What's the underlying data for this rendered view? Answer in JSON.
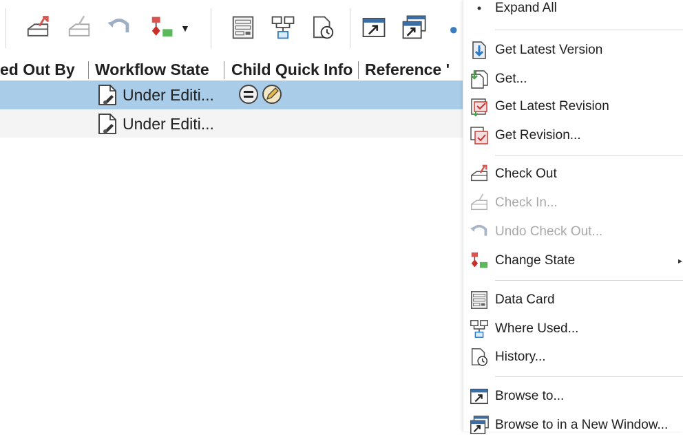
{
  "toolbar": {
    "buttons": [
      {
        "name": "check-out",
        "icon": "check-out-icon"
      },
      {
        "name": "check-in",
        "icon": "check-in-icon"
      },
      {
        "name": "undo-check-out",
        "icon": "undo-check-out-icon"
      },
      {
        "name": "change-state",
        "icon": "change-state-icon"
      },
      {
        "name": "data-card",
        "icon": "data-card-icon"
      },
      {
        "name": "where-used",
        "icon": "where-used-icon"
      },
      {
        "name": "history",
        "icon": "history-icon"
      },
      {
        "name": "browse-to",
        "icon": "browse-to-icon"
      },
      {
        "name": "browse-new-window",
        "icon": "browse-new-window-icon"
      }
    ]
  },
  "grid": {
    "columns": [
      "ed Out By",
      "Workflow State",
      "Child Quick Info",
      "Reference '"
    ],
    "rows": [
      {
        "state": "Under Editi...",
        "selected": true
      },
      {
        "state": "Under Editi...",
        "selected": false
      }
    ]
  },
  "menu": {
    "items": [
      {
        "label": "Expand All",
        "icon": "expand-icon",
        "enabled": true
      },
      {
        "label": "Get Latest Version",
        "icon": "get-latest-version-icon",
        "enabled": true
      },
      {
        "label": "Get...",
        "icon": "get-icon",
        "enabled": true
      },
      {
        "label": "Get Latest Revision",
        "icon": "get-latest-revision-icon",
        "enabled": true
      },
      {
        "label": "Get Revision...",
        "icon": "get-revision-icon",
        "enabled": true
      },
      {
        "label": "Check Out",
        "icon": "check-out-icon",
        "enabled": true
      },
      {
        "label": "Check In...",
        "icon": "check-in-icon",
        "enabled": false
      },
      {
        "label": "Undo Check Out...",
        "icon": "undo-check-out-icon",
        "enabled": false
      },
      {
        "label": "Change State",
        "icon": "change-state-icon",
        "enabled": true,
        "submenu": true
      },
      {
        "label": "Data Card",
        "icon": "data-card-icon",
        "enabled": true
      },
      {
        "label": "Where Used...",
        "icon": "where-used-icon",
        "enabled": true
      },
      {
        "label": "History...",
        "icon": "history-icon",
        "enabled": true
      },
      {
        "label": "Browse to...",
        "icon": "browse-to-icon",
        "enabled": true
      },
      {
        "label": "Browse to in a New Window...",
        "icon": "browse-new-window-icon",
        "enabled": true
      }
    ]
  },
  "colors": {
    "selection": "#a9cce8",
    "checkout_red": "#d9534f",
    "state_green": "#5cb85c"
  }
}
